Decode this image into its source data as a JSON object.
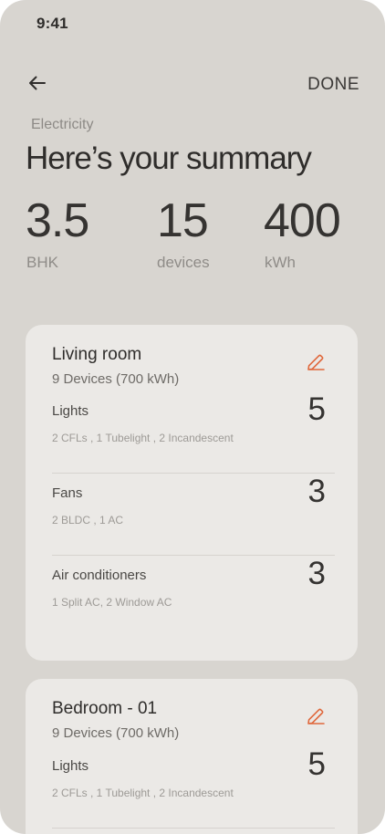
{
  "status_bar": {
    "time": "9:41"
  },
  "header": {
    "done_label": "DONE",
    "overline": "Electricity",
    "title": "Here’s your summary",
    "back_icon": "arrow-left-icon"
  },
  "stats": [
    {
      "value": "3.5",
      "label": "BHK"
    },
    {
      "value": "15",
      "label": "devices"
    },
    {
      "value": "400",
      "label": "kWh"
    }
  ],
  "accent_color": "#e0683c",
  "rooms": [
    {
      "name": "Living room",
      "summary": "9 Devices (700 kWh)",
      "edit_icon": "pencil-icon",
      "items": [
        {
          "name": "Lights",
          "count": "5",
          "detail": "2 CFLs , 1 Tubelight , 2 Incandescent"
        },
        {
          "name": "Fans",
          "count": "3",
          "detail": "2 BLDC , 1 AC"
        },
        {
          "name": "Air conditioners",
          "count": "3",
          "detail": "1 Split AC, 2 Window AC"
        }
      ]
    },
    {
      "name": "Bedroom - 01",
      "summary": "9 Devices (700 kWh)",
      "edit_icon": "pencil-icon",
      "items": [
        {
          "name": "Lights",
          "count": "5",
          "detail": "2 CFLs , 1 Tubelight , 2 Incandescent"
        }
      ]
    }
  ]
}
